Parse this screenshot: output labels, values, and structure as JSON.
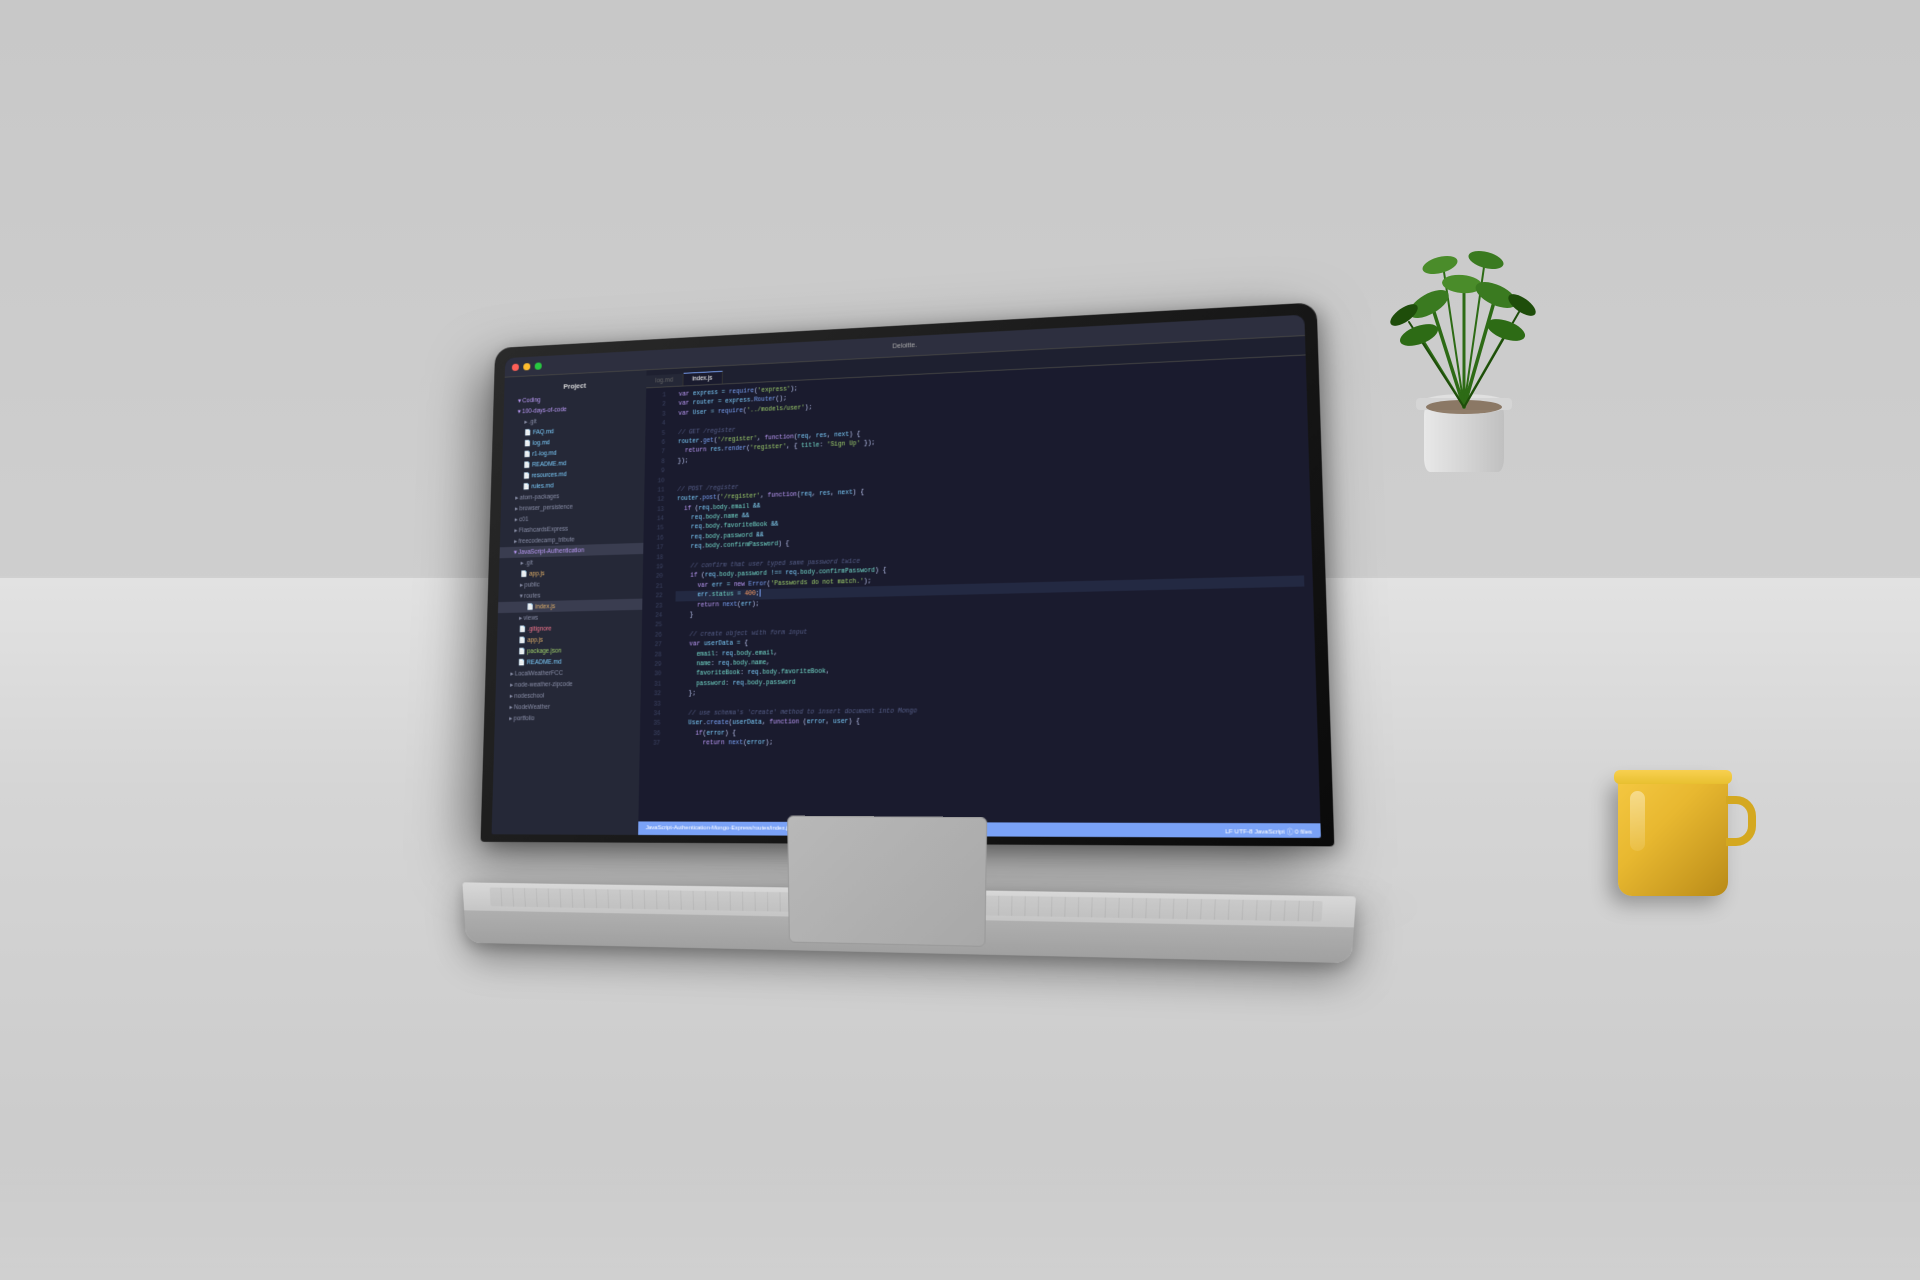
{
  "scene": {
    "title": "Coding setup on desk"
  },
  "laptop": {
    "brand": "Deloitte.",
    "sidebar": {
      "title": "Project",
      "items": [
        {
          "label": "Coding",
          "type": "folder",
          "level": 0
        },
        {
          "label": "100-days-of-code",
          "type": "folder",
          "level": 1
        },
        {
          "label": ".git",
          "type": "folder",
          "level": 2
        },
        {
          "label": "FAQ.md",
          "type": "file-md",
          "level": 2
        },
        {
          "label": "log.md",
          "type": "file-md",
          "level": 2
        },
        {
          "label": "r1-log.md",
          "type": "file-md",
          "level": 2
        },
        {
          "label": "README.md",
          "type": "file-md",
          "level": 2
        },
        {
          "label": "resources.md",
          "type": "file-md",
          "level": 2
        },
        {
          "label": "rules.md",
          "type": "file-md",
          "level": 2
        },
        {
          "label": "atom-packages",
          "type": "folder",
          "level": 1
        },
        {
          "label": "browser_persistence",
          "type": "folder",
          "level": 1
        },
        {
          "label": "c01",
          "type": "folder",
          "level": 1
        },
        {
          "label": "FlashcardsExpress",
          "type": "folder",
          "level": 1
        },
        {
          "label": "freecodecamp_tribute",
          "type": "folder",
          "level": 1
        },
        {
          "label": "JavaScript-Authentication",
          "type": "folder",
          "level": 1,
          "active": true
        },
        {
          "label": ".git",
          "type": "folder",
          "level": 2
        },
        {
          "label": "app.js",
          "type": "file-js",
          "level": 2
        },
        {
          "label": "public",
          "type": "folder",
          "level": 2
        },
        {
          "label": "routes",
          "type": "folder",
          "level": 2
        },
        {
          "label": "index.js",
          "type": "file-js",
          "level": 3,
          "active": true
        },
        {
          "label": "views",
          "type": "folder",
          "level": 2
        },
        {
          "label": ".gitignore",
          "type": "file-git",
          "level": 2
        },
        {
          "label": "app.js",
          "type": "file-js",
          "level": 2
        },
        {
          "label": "package.json",
          "type": "file-json",
          "level": 2
        },
        {
          "label": "README.md",
          "type": "file-md",
          "level": 2
        },
        {
          "label": "LocalWeatherFCC",
          "type": "folder",
          "level": 1
        },
        {
          "label": "node-weather-zipcode",
          "type": "folder",
          "level": 1
        },
        {
          "label": "nodeschool",
          "type": "folder",
          "level": 1
        },
        {
          "label": "NodeWeather",
          "type": "folder",
          "level": 1
        },
        {
          "label": "portfolio",
          "type": "folder",
          "level": 1
        }
      ]
    },
    "tabs": [
      {
        "label": "log.md",
        "active": false
      },
      {
        "label": "index.js",
        "active": true
      }
    ],
    "code": {
      "lines": [
        {
          "num": "1",
          "content": "var express = require('express');",
          "type": "code"
        },
        {
          "num": "2",
          "content": "var router = express.Router();",
          "type": "code"
        },
        {
          "num": "3",
          "content": "var User = require('../models/user');",
          "type": "code"
        },
        {
          "num": "4",
          "content": "",
          "type": "blank"
        },
        {
          "num": "5",
          "content": "// GET /register",
          "type": "comment"
        },
        {
          "num": "6",
          "content": "router.get('/register', function(req, res, next) {",
          "type": "code"
        },
        {
          "num": "7",
          "content": "  return res.render('register', { title: 'Sign Up' });",
          "type": "code"
        },
        {
          "num": "8",
          "content": "});",
          "type": "code"
        },
        {
          "num": "9",
          "content": "",
          "type": "blank"
        },
        {
          "num": "10",
          "content": "",
          "type": "blank"
        },
        {
          "num": "11",
          "content": "// POST /register",
          "type": "comment"
        },
        {
          "num": "12",
          "content": "router.post('/register', function(req, res, next) {",
          "type": "code"
        },
        {
          "num": "13",
          "content": "  if (req.body.email &&",
          "type": "code"
        },
        {
          "num": "14",
          "content": "    req.body.name &&",
          "type": "code"
        },
        {
          "num": "15",
          "content": "    req.body.favoriteBook &&",
          "type": "code"
        },
        {
          "num": "16",
          "content": "    req.body.password &&",
          "type": "code"
        },
        {
          "num": "17",
          "content": "    req.body.confirmPassword) {",
          "type": "code"
        },
        {
          "num": "18",
          "content": "",
          "type": "blank"
        },
        {
          "num": "19",
          "content": "    // confirm that user typed same password twice",
          "type": "comment"
        },
        {
          "num": "20",
          "content": "    if (req.body.password !== req.body.confirmPassword) {",
          "type": "code"
        },
        {
          "num": "21",
          "content": "      var err = new Error('Passwords do not match.');",
          "type": "code"
        },
        {
          "num": "22",
          "content": "      err.status = 400;",
          "type": "code"
        },
        {
          "num": "23",
          "content": "      return next(err);",
          "type": "code"
        },
        {
          "num": "24",
          "content": "    }",
          "type": "code"
        },
        {
          "num": "25",
          "content": "",
          "type": "blank"
        },
        {
          "num": "26",
          "content": "    // create object with form input",
          "type": "comment"
        },
        {
          "num": "27",
          "content": "    var userData = {",
          "type": "code"
        },
        {
          "num": "28",
          "content": "      email: req.body.email,",
          "type": "code"
        },
        {
          "num": "29",
          "content": "      name: req.body.name,",
          "type": "code"
        },
        {
          "num": "30",
          "content": "      favoriteBook: req.body.favoriteBook,",
          "type": "code"
        },
        {
          "num": "31",
          "content": "      password: req.body.password",
          "type": "code"
        },
        {
          "num": "32",
          "content": "    };",
          "type": "code"
        },
        {
          "num": "33",
          "content": "",
          "type": "blank"
        },
        {
          "num": "34",
          "content": "    // use schema's 'create' method to insert document into Mongo",
          "type": "comment"
        },
        {
          "num": "35",
          "content": "    User.create(userData, function (error, user) {",
          "type": "code"
        },
        {
          "num": "36",
          "content": "      if(error) {",
          "type": "code"
        },
        {
          "num": "37",
          "content": "        return next(error);",
          "type": "code"
        }
      ]
    },
    "statusbar": {
      "left": "JavaScript-Authentication-Mongo-Express/routes/index.js  1:1",
      "right": "LF  UTF-8  JavaScript  ⓘ 0 files"
    }
  },
  "plant": {
    "description": "Green potted plant"
  },
  "mug": {
    "color": "#f5c842",
    "description": "Yellow ceramic mug"
  }
}
